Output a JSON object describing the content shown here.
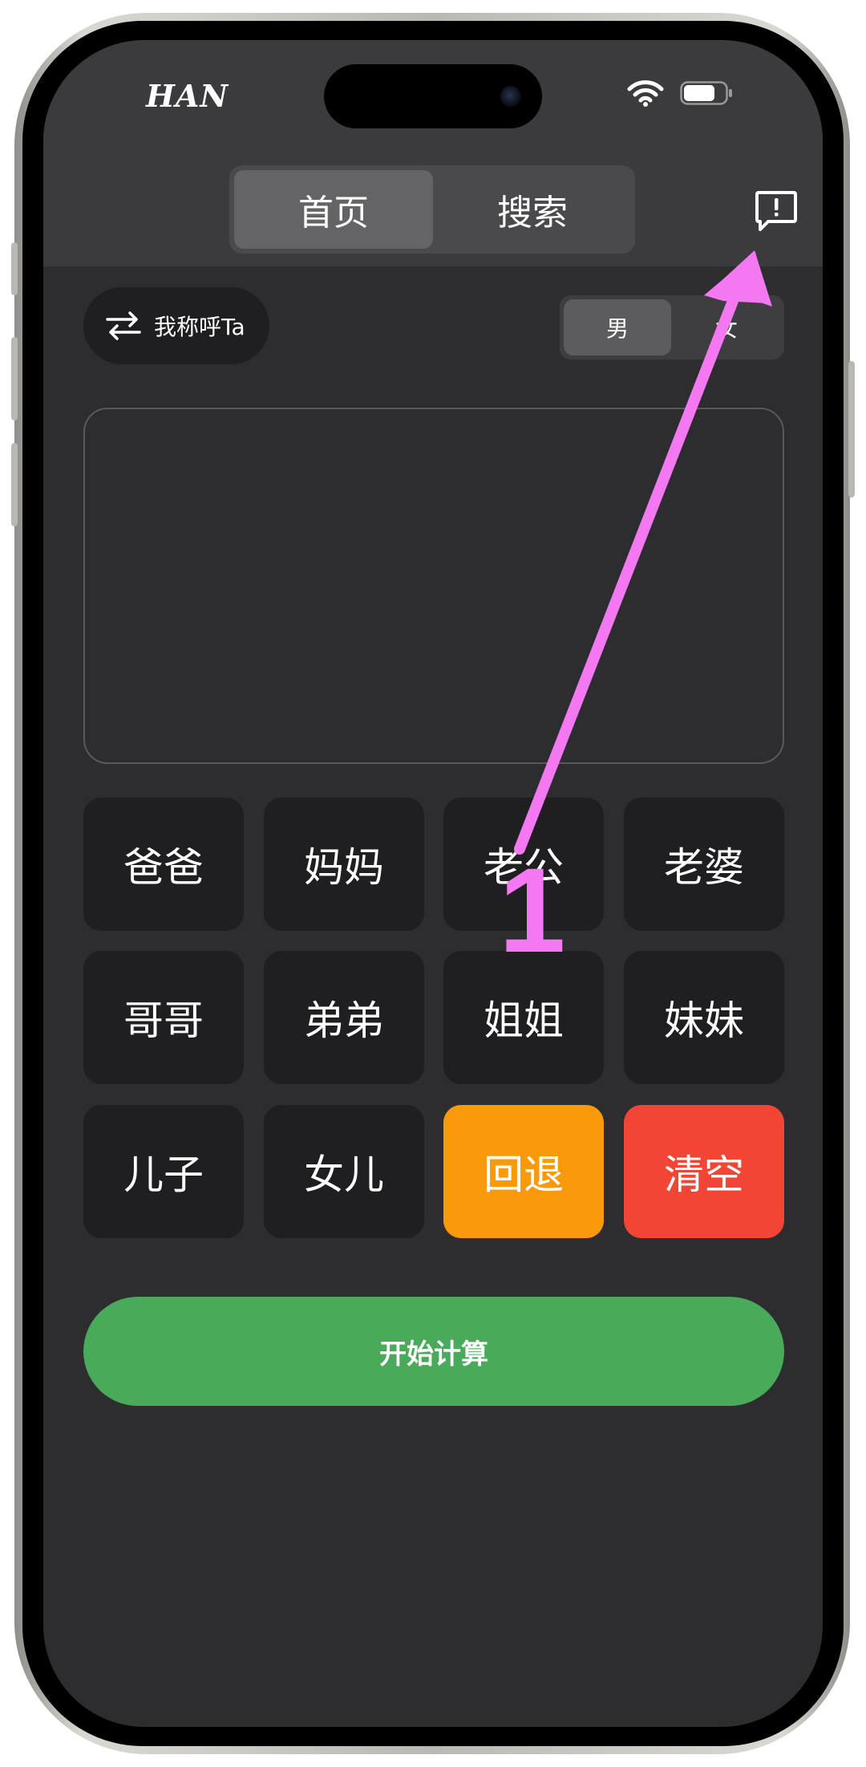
{
  "status_bar": {
    "carrier_label": "HAN",
    "wifi_icon": "wifi-icon",
    "battery_icon": "battery-icon"
  },
  "header": {
    "tabs": [
      {
        "label": "首页",
        "selected": true
      },
      {
        "label": "搜索",
        "selected": false
      }
    ],
    "feedback_icon": "message-alert-icon"
  },
  "controls": {
    "swap_label": "我称呼Ta",
    "swap_icon": "swap-arrows-icon",
    "gender_options": [
      {
        "label": "男",
        "selected": true
      },
      {
        "label": "女",
        "selected": false
      }
    ]
  },
  "display": {
    "text": ""
  },
  "keypad": {
    "keys": [
      {
        "label": "爸爸",
        "type": "relation"
      },
      {
        "label": "妈妈",
        "type": "relation"
      },
      {
        "label": "老公",
        "type": "relation"
      },
      {
        "label": "老婆",
        "type": "relation"
      },
      {
        "label": "哥哥",
        "type": "relation"
      },
      {
        "label": "弟弟",
        "type": "relation"
      },
      {
        "label": "姐姐",
        "type": "relation"
      },
      {
        "label": "妹妹",
        "type": "relation"
      },
      {
        "label": "儿子",
        "type": "relation"
      },
      {
        "label": "女儿",
        "type": "relation"
      },
      {
        "label": "回退",
        "type": "backspace"
      },
      {
        "label": "清空",
        "type": "clear"
      }
    ]
  },
  "actions": {
    "calculate_label": "开始计算"
  },
  "annotation": {
    "step_number": "1",
    "color": "#f478f2"
  },
  "colors": {
    "screen_bg": "#2d2d2f",
    "header_bg": "#3b3b3d",
    "key_bg": "#1f1f21",
    "backspace": "#fa9a0a",
    "clear": "#f24535",
    "calculate": "#49aa5a"
  }
}
